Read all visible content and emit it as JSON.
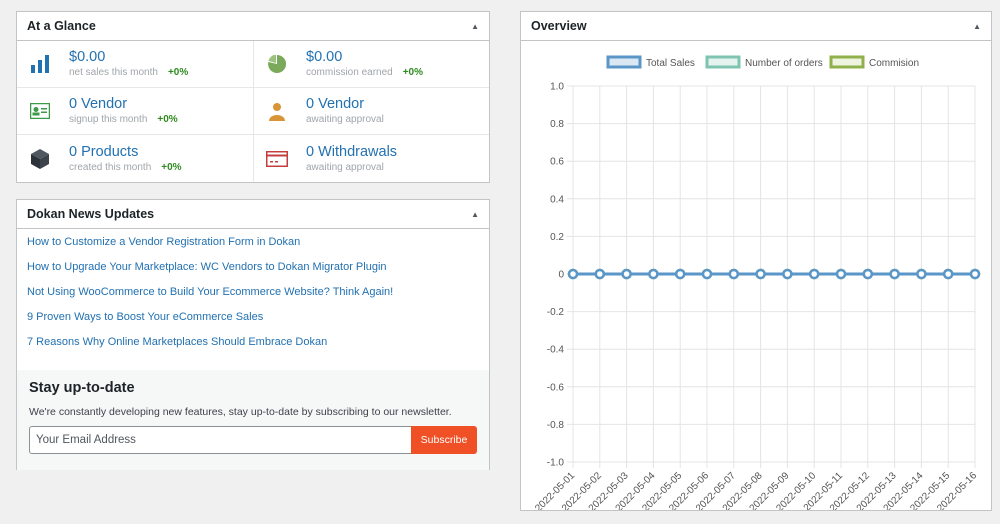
{
  "glance": {
    "title": "At a Glance",
    "toggle": "▲",
    "items": [
      {
        "value": "$0.00",
        "label": "net sales this month",
        "change": "+0%",
        "icon": "bar-chart-icon"
      },
      {
        "value": "$0.00",
        "label": "commission earned",
        "change": "+0%",
        "icon": "pie-chart-icon"
      },
      {
        "value": "0 Vendor",
        "label": "signup this month",
        "change": "+0%",
        "icon": "id-card-icon"
      },
      {
        "value": "0 Vendor",
        "label": "awaiting approval",
        "icon": "person-icon"
      },
      {
        "value": "0 Products",
        "label": "created this month",
        "change": "+0%",
        "icon": "cube-icon"
      },
      {
        "value": "0 Withdrawals",
        "label": "awaiting approval",
        "icon": "credit-card-icon"
      }
    ],
    "colors": {
      "bar": "#2271b1",
      "pie": "#7aa95c",
      "card": "#3c9a48",
      "person": "#d89537",
      "cube": "#3c434a",
      "withdraw": "#c33f3f"
    }
  },
  "news": {
    "title": "Dokan News Updates",
    "toggle": "▲",
    "links": [
      "How to Customize a Vendor Registration Form in Dokan",
      "How to Upgrade Your Marketplace: WC Vendors to Dokan Migrator Plugin",
      "Not Using WooCommerce to Build Your Ecommerce Website? Think Again!",
      "9 Proven Ways to Boost Your eCommerce Sales",
      "7 Reasons Why Online Marketplaces Should Embrace Dokan"
    ],
    "subscribe": {
      "heading": "Stay up-to-date",
      "text": "We're constantly developing new features, stay up-to-date by subscribing to our newsletter.",
      "placeholder": "Your Email Address",
      "button": "Subscribe",
      "button_color": "#f05025"
    }
  },
  "overview": {
    "title": "Overview",
    "toggle": "▲"
  },
  "chart_data": {
    "type": "line",
    "title": "",
    "xlabel": "",
    "ylabel": "",
    "ylim": [
      -1.0,
      1.0
    ],
    "yticks": [
      "1.0",
      "0.8",
      "0.6",
      "0.4",
      "0.2",
      "0",
      "-0.2",
      "-0.4",
      "-0.6",
      "-0.8",
      "-1.0"
    ],
    "x": [
      "2022-05-01",
      "2022-05-02",
      "2022-05-03",
      "2022-05-04",
      "2022-05-05",
      "2022-05-06",
      "2022-05-07",
      "2022-05-08",
      "2022-05-09",
      "2022-05-10",
      "2022-05-11",
      "2022-05-12",
      "2022-05-13",
      "2022-05-14",
      "2022-05-15",
      "2022-05-16"
    ],
    "series": [
      {
        "name": "Total Sales",
        "values": [
          0,
          0,
          0,
          0,
          0,
          0,
          0,
          0,
          0,
          0,
          0,
          0,
          0,
          0,
          0,
          0
        ],
        "color": "#5b96c9",
        "fill": "#dbe8f4"
      },
      {
        "name": "Number of orders",
        "values": [
          0,
          0,
          0,
          0,
          0,
          0,
          0,
          0,
          0,
          0,
          0,
          0,
          0,
          0,
          0,
          0
        ],
        "color": "#7ec4b0",
        "fill": "#e4f3ee"
      },
      {
        "name": "Commision",
        "values": [
          0,
          0,
          0,
          0,
          0,
          0,
          0,
          0,
          0,
          0,
          0,
          0,
          0,
          0,
          0,
          0
        ],
        "color": "#8fb04b",
        "fill": "#eef4df"
      }
    ],
    "legend": "top-center",
    "grid": true
  }
}
